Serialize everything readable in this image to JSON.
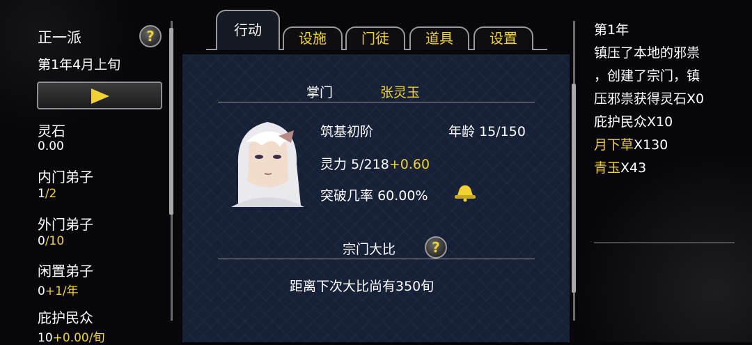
{
  "sidebar": {
    "sect_name": "正一派",
    "date": "第1年4月上旬",
    "stats": [
      {
        "label": "灵石",
        "value": "0.00"
      },
      {
        "label": "内门弟子",
        "value_a": "1",
        "value_b": "/2"
      },
      {
        "label": "外门弟子",
        "value_a": "0",
        "value_b": "/10"
      },
      {
        "label": "闲置弟子",
        "value_a": "0",
        "value_b": "+1/年"
      },
      {
        "label": "庇护民众",
        "value_a": "10",
        "value_b": "+0.00/旬"
      }
    ]
  },
  "tabs": [
    "行动",
    "设施",
    "门徒",
    "道具",
    "设置"
  ],
  "leader": {
    "title": "掌门",
    "name": "张灵玉",
    "realm": "筑基初阶",
    "age_label": "年龄",
    "age": "15/150",
    "power_label": "灵力",
    "power": "5/218",
    "power_gain": "+0.60",
    "breakthrough_label": "突破几率",
    "breakthrough": "60.00%"
  },
  "tournament": {
    "title": "宗门大比",
    "countdown": "距离下次大比尚有350旬"
  },
  "log": {
    "year": "第1年",
    "lines": [
      "镇压了本地的邪祟",
      "，创建了宗门，镇",
      "压邪祟获得灵石X0",
      "庇护民众X10"
    ],
    "rewards": [
      {
        "item": "月下草",
        "qty": "X130"
      },
      {
        "item": "青玉",
        "qty": "X43"
      }
    ]
  },
  "colors": {
    "accent": "#f1d234",
    "panel": "#162036"
  },
  "icons": [
    "help-icon",
    "play-icon",
    "bell-icon"
  ]
}
